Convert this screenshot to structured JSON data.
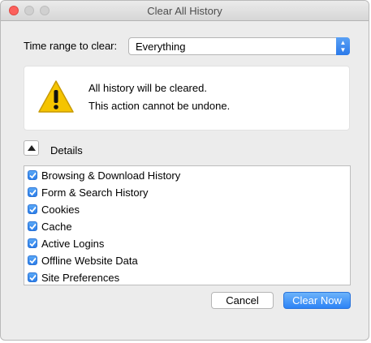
{
  "window": {
    "title": "Clear All History"
  },
  "time_range": {
    "label": "Time range to clear:",
    "selected": "Everything"
  },
  "warning": {
    "line1": "All history will be cleared.",
    "line2": "This action cannot be undone."
  },
  "details": {
    "label": "Details",
    "expanded": true,
    "items": [
      {
        "label": "Browsing & Download History",
        "checked": true
      },
      {
        "label": "Form & Search History",
        "checked": true
      },
      {
        "label": "Cookies",
        "checked": true
      },
      {
        "label": "Cache",
        "checked": true
      },
      {
        "label": "Active Logins",
        "checked": true
      },
      {
        "label": "Offline Website Data",
        "checked": true
      },
      {
        "label": "Site Preferences",
        "checked": true
      }
    ]
  },
  "buttons": {
    "cancel": "Cancel",
    "clear_now": "Clear Now"
  },
  "colors": {
    "accent": "#2d83f6",
    "close_button": "#fc605c",
    "warning_yellow": "#f5c400"
  },
  "icons": {
    "warning": "warning-triangle-icon",
    "disclosure": "disclosure-triangle-up-icon",
    "checkbox": "checkmark-icon"
  }
}
